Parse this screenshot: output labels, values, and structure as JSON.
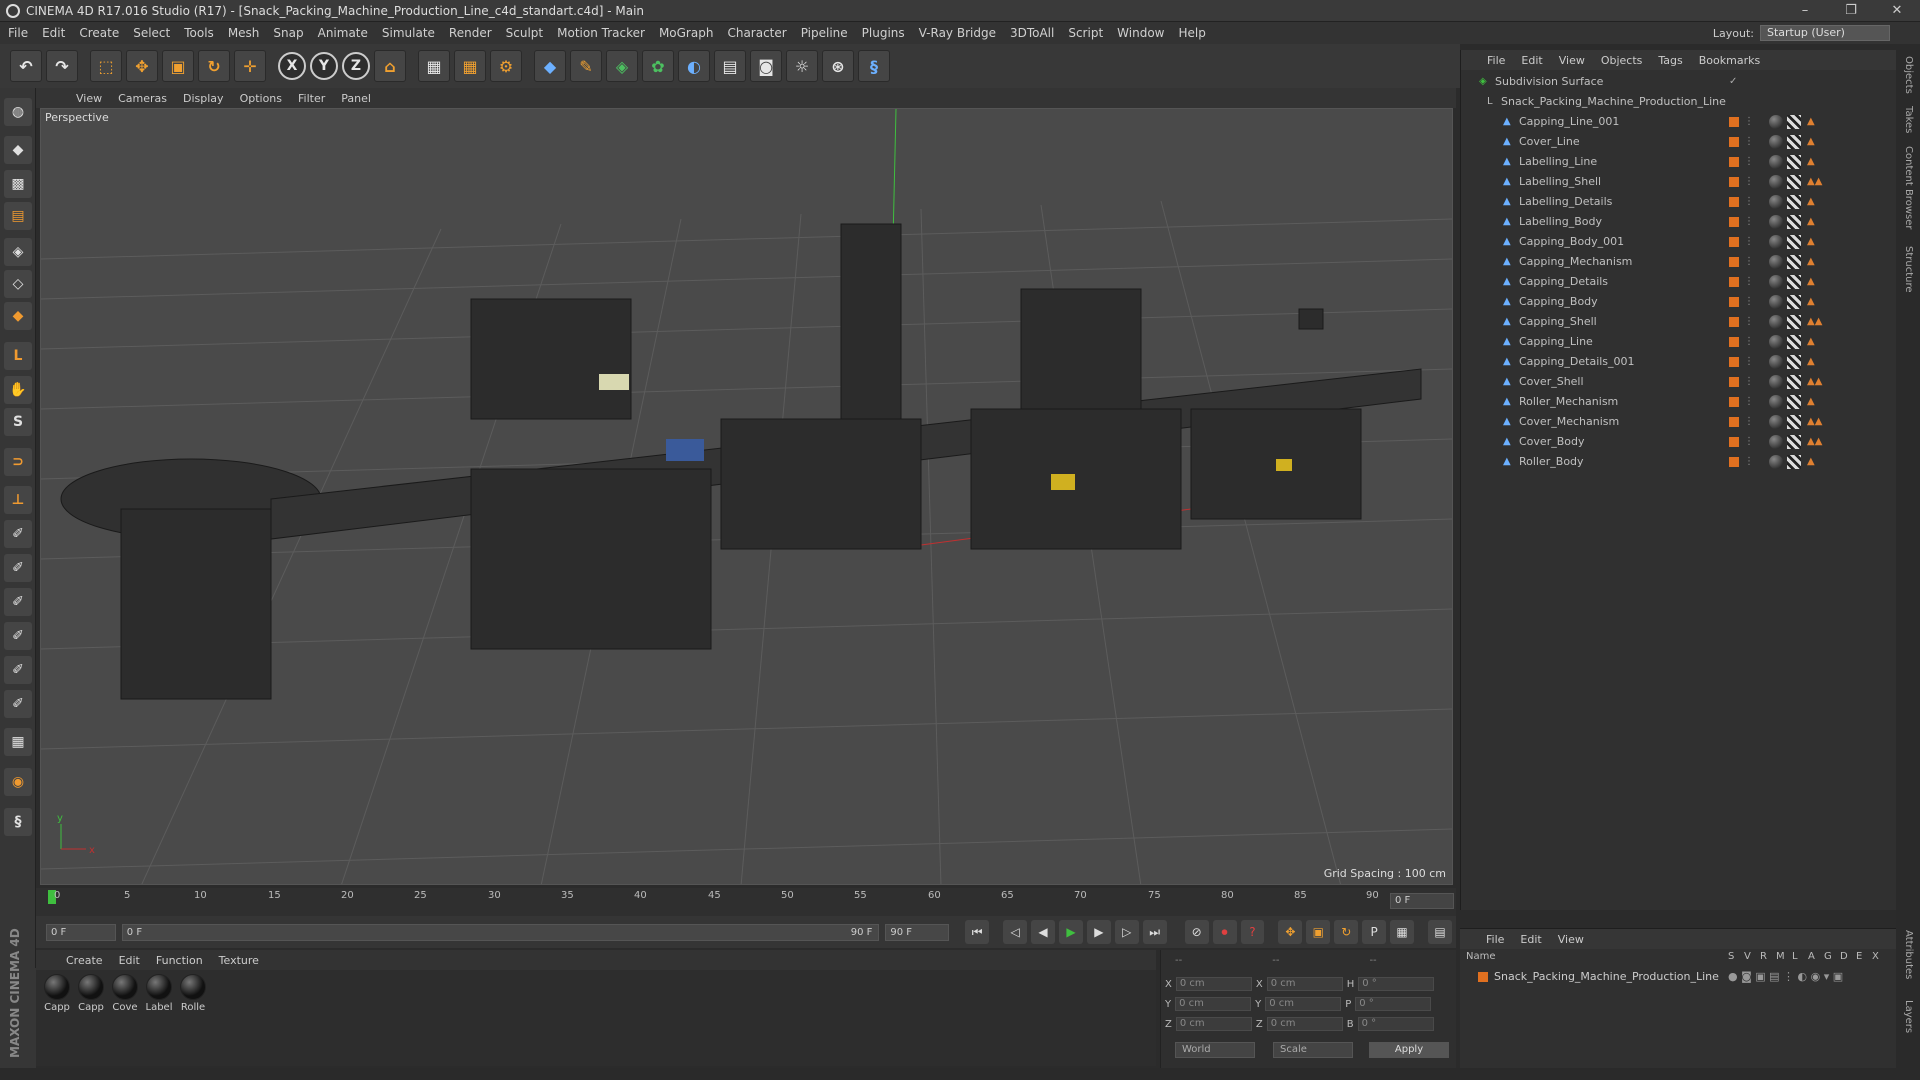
{
  "window": {
    "title": "CINEMA 4D R17.016 Studio (R17) - [Snack_Packing_Machine_Production_Line_c4d_standart.c4d] - Main",
    "controls": [
      "–",
      "❐",
      "✕"
    ]
  },
  "menubar": [
    "File",
    "Edit",
    "Create",
    "Select",
    "Tools",
    "Mesh",
    "Snap",
    "Animate",
    "Simulate",
    "Render",
    "Sculpt",
    "Motion Tracker",
    "MoGraph",
    "Character",
    "Pipeline",
    "Plugins",
    "V-Ray Bridge",
    "3DToAll",
    "Script",
    "Window",
    "Help"
  ],
  "layout": {
    "label": "Layout:",
    "value": "Startup (User)"
  },
  "viewport": {
    "menu": [
      "View",
      "Cameras",
      "Display",
      "Options",
      "Filter",
      "Panel"
    ],
    "label": "Perspective",
    "grid_spacing": "Grid Spacing : 100 cm",
    "axis_x": "x",
    "axis_y": "y"
  },
  "timeline": {
    "ticks": [
      "0",
      "5",
      "10",
      "15",
      "20",
      "25",
      "30",
      "35",
      "40",
      "45",
      "50",
      "55",
      "60",
      "65",
      "70",
      "75",
      "80",
      "85",
      "90"
    ],
    "frame_end": "0 F",
    "current": "0 F",
    "range_start": "0 F",
    "range_bar_start": "0 F",
    "range_bar_end": "90 F",
    "range_end": "90 F"
  },
  "material_manager": {
    "menu": [
      "Create",
      "Edit",
      "Function",
      "Texture"
    ],
    "materials": [
      "Capp",
      "Capp",
      "Cove",
      "Label",
      "Rolle"
    ],
    "brand": "MAXON CINEMA 4D"
  },
  "coordinates": {
    "header": [
      "--",
      "--",
      "--"
    ],
    "rows": [
      {
        "a": "X",
        "av": "0 cm",
        "b": "X",
        "bv": "0 cm",
        "c": "H",
        "cv": "0 °"
      },
      {
        "a": "Y",
        "av": "0 cm",
        "b": "Y",
        "bv": "0 cm",
        "c": "P",
        "cv": "0 °"
      },
      {
        "a": "Z",
        "av": "0 cm",
        "b": "Z",
        "bv": "0 cm",
        "c": "B",
        "cv": "0 °"
      }
    ],
    "world": "World",
    "scale": "Scale",
    "apply": "Apply"
  },
  "object_manager": {
    "menu": [
      "File",
      "Edit",
      "View",
      "Objects",
      "Tags",
      "Bookmarks"
    ],
    "root": "Subdivision Surface",
    "group": "Snack_Packing_Machine_Production_Line",
    "objects": [
      "Capping_Line_001",
      "Cover_Line",
      "Labelling_Line",
      "Labelling_Shell",
      "Labelling_Details",
      "Labelling_Body",
      "Capping_Body_001",
      "Capping_Mechanism",
      "Capping_Details",
      "Capping_Body",
      "Capping_Shell",
      "Capping_Line",
      "Capping_Details_001",
      "Cover_Shell",
      "Roller_Mechanism",
      "Cover_Mechanism",
      "Cover_Body",
      "Roller_Body"
    ]
  },
  "layer_manager": {
    "menu": [
      "File",
      "Edit",
      "View"
    ],
    "columns": [
      "Name",
      "S",
      "V",
      "R",
      "M",
      "L",
      "A",
      "G",
      "D",
      "E",
      "X"
    ],
    "layer": "Snack_Packing_Machine_Production_Line"
  },
  "side_tabs": [
    "Objects",
    "Takes",
    "Content Browser",
    "Structure"
  ],
  "side_tabs_lower": [
    "Attributes",
    "Layers"
  ]
}
